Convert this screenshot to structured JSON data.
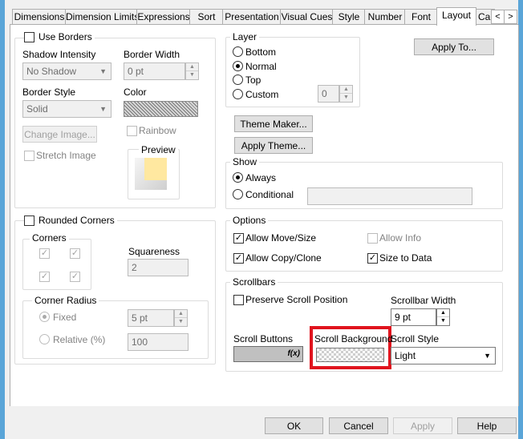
{
  "tabs": [
    {
      "label": "Dimensions"
    },
    {
      "label": "Dimension Limits"
    },
    {
      "label": "Expressions"
    },
    {
      "label": "Sort"
    },
    {
      "label": "Presentation"
    },
    {
      "label": "Visual Cues"
    },
    {
      "label": "Style"
    },
    {
      "label": "Number"
    },
    {
      "label": "Font"
    },
    {
      "label": "Layout"
    },
    {
      "label": "Cap"
    }
  ],
  "tab_scroll": {
    "left": "<",
    "right": ">"
  },
  "borders": {
    "use_borders_label": "Use Borders",
    "shadow_intensity_label": "Shadow Intensity",
    "shadow_intensity_value": "No Shadow",
    "border_width_label": "Border Width",
    "border_width_value": "0 pt",
    "border_style_label": "Border Style",
    "border_style_value": "Solid",
    "color_label": "Color",
    "change_image_label": "Change Image...",
    "rainbow_label": "Rainbow",
    "stretch_image_label": "Stretch Image",
    "preview_label": "Preview"
  },
  "layer": {
    "title": "Layer",
    "bottom": "Bottom",
    "normal": "Normal",
    "top": "Top",
    "custom": "Custom",
    "custom_value": "0",
    "selected": "Normal"
  },
  "apply_to_label": "Apply To...",
  "theme_maker_label": "Theme Maker...",
  "apply_theme_label": "Apply Theme...",
  "show": {
    "title": "Show",
    "always": "Always",
    "conditional": "Conditional"
  },
  "rounded": {
    "rounded_corners_label": "Rounded Corners",
    "corners_label": "Corners",
    "squareness_label": "Squareness",
    "squareness_value": "2",
    "corner_radius_label": "Corner Radius",
    "fixed_label": "Fixed",
    "fixed_value": "5 pt",
    "relative_label": "Relative (%)",
    "relative_value": "100"
  },
  "options": {
    "title": "Options",
    "allow_move_size": "Allow Move/Size",
    "allow_info": "Allow Info",
    "allow_copy_clone": "Allow Copy/Clone",
    "size_to_data": "Size to Data"
  },
  "scrollbars": {
    "title": "Scrollbars",
    "preserve_scroll_position": "Preserve Scroll Position",
    "scrollbar_width_label": "Scrollbar Width",
    "scrollbar_width_value": "9 pt",
    "scroll_buttons_label": "Scroll Buttons",
    "scroll_buttons_fx": "f(x)",
    "scroll_background_label": "Scroll Background",
    "scroll_style_label": "Scroll Style",
    "scroll_style_value": "Light"
  },
  "footer": {
    "ok": "OK",
    "cancel": "Cancel",
    "apply": "Apply",
    "help": "Help"
  },
  "colors": {
    "highlight": "#e0141e",
    "window_bg": "#f0f0f0",
    "preview_fill": "#ffe8a0"
  }
}
